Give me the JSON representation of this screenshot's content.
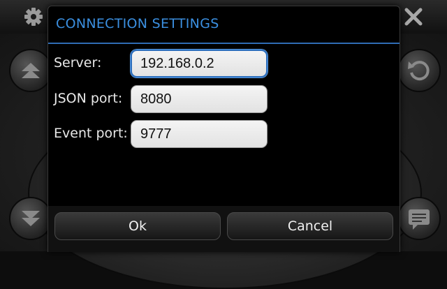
{
  "dialog": {
    "title": "CONNECTION SETTINGS",
    "fields": [
      {
        "label": "Server:",
        "value": "192.168.0.2"
      },
      {
        "label": "JSON port:",
        "value": "8080"
      },
      {
        "label": "Event port:",
        "value": "9777"
      }
    ],
    "ok_label": "Ok",
    "cancel_label": "Cancel"
  },
  "theme": {
    "accent": "#3b8fe0",
    "focus_border": "#2d6fbe",
    "dialog_bg": "#000000"
  },
  "icons": {
    "top_left": "gear-icon",
    "top_right": "close-icon",
    "left_upper": "page-up-icon",
    "left_lower": "page-down-icon",
    "right_upper": "back-icon",
    "right_lower": "chat-icon"
  }
}
